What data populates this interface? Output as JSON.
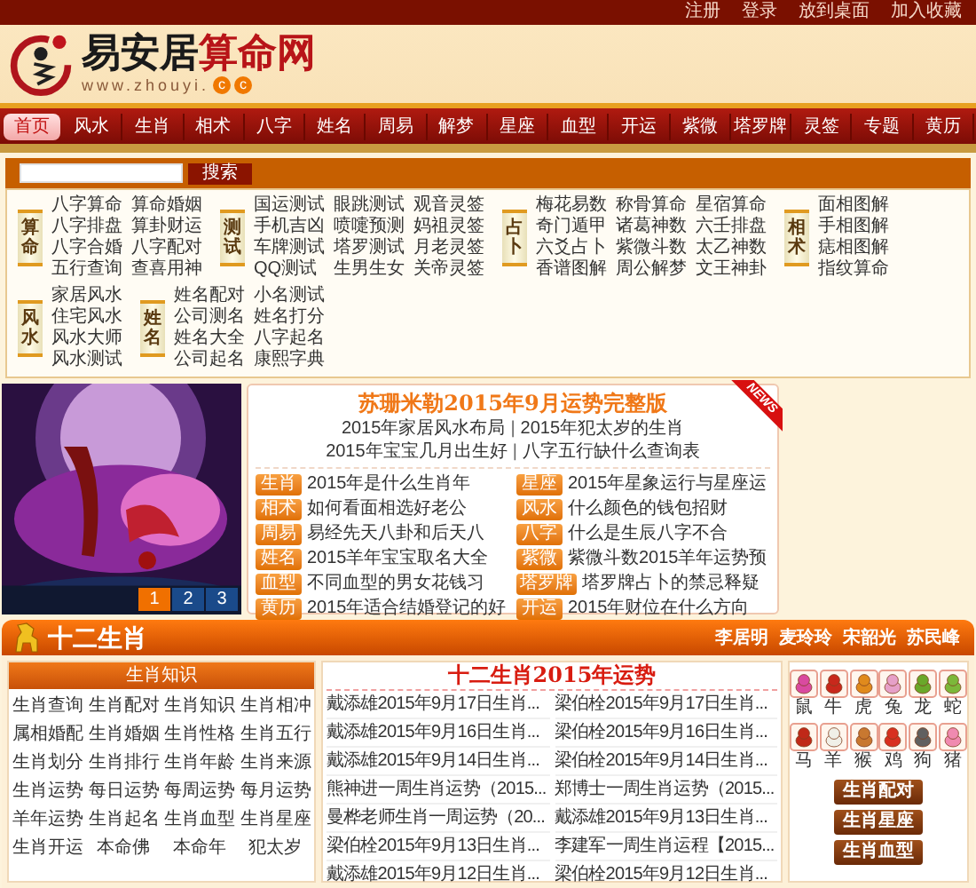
{
  "top_links": [
    "注册",
    "登录",
    "放到桌面",
    "加入收藏"
  ],
  "logo": {
    "name_black": "易安居",
    "name_red": "算命网",
    "url": "www.zhouyi.",
    "url_badges": [
      "c",
      "c"
    ]
  },
  "nav": [
    {
      "label": "首页",
      "selected": true
    },
    {
      "label": "风水",
      "selected": false
    },
    {
      "label": "生肖",
      "selected": false
    },
    {
      "label": "相术",
      "selected": false
    },
    {
      "label": "八字",
      "selected": false
    },
    {
      "label": "姓名",
      "selected": false
    },
    {
      "label": "周易",
      "selected": false
    },
    {
      "label": "解梦",
      "selected": false
    },
    {
      "label": "星座",
      "selected": false
    },
    {
      "label": "血型",
      "selected": false
    },
    {
      "label": "开运",
      "selected": false
    },
    {
      "label": "紫微",
      "selected": false
    },
    {
      "label": "塔罗牌",
      "selected": false
    },
    {
      "label": "灵签",
      "selected": false
    },
    {
      "label": "专题",
      "selected": false
    },
    {
      "label": "黄历",
      "selected": false
    }
  ],
  "search": {
    "button": "搜索"
  },
  "categories": [
    {
      "label": "算命",
      "columns": [
        [
          "八字算命",
          "八字排盘",
          "八字合婚",
          "五行查询"
        ],
        [
          "算命婚姻",
          "算卦财运",
          "八字配对",
          "查喜用神"
        ]
      ]
    },
    {
      "label": "测试",
      "columns": [
        [
          "国运测试",
          "手机吉凶",
          "车牌测试",
          "QQ测试"
        ],
        [
          "眼跳测试",
          "喷嚏预测",
          "塔罗测试",
          "生男生女"
        ],
        [
          "观音灵签",
          "妈祖灵签",
          "月老灵签",
          "关帝灵签"
        ]
      ]
    },
    {
      "label": "占卜",
      "columns": [
        [
          "梅花易数",
          "奇门遁甲",
          "六爻占卜",
          "香谱图解"
        ],
        [
          "称骨算命",
          "诸葛神数",
          "紫微斗数",
          "周公解梦"
        ],
        [
          "星宿算命",
          "六壬排盘",
          "太乙神数",
          "文王神卦"
        ]
      ]
    },
    {
      "label": "相术",
      "columns": [
        [
          "面相图解",
          "手相图解",
          "痣相图解",
          "指纹算命"
        ]
      ]
    },
    {
      "label": "风水",
      "columns": [
        [
          "家居风水",
          "住宅风水",
          "风水大师",
          "风水测试"
        ]
      ]
    },
    {
      "label": "姓名",
      "columns": [
        [
          "姓名配对",
          "公司测名",
          "姓名大全",
          "公司起名"
        ],
        [
          "小名测试",
          "姓名打分",
          "八字起名",
          "康熙字典"
        ]
      ]
    }
  ],
  "slideshow": {
    "pages": [
      {
        "label": "1",
        "selected": true
      },
      {
        "label": "2",
        "selected": false
      },
      {
        "label": "3",
        "selected": false
      }
    ]
  },
  "news": {
    "ribbon": "NEWS",
    "headline": "苏珊米勒2015年9月运势完整版",
    "sub_lines": [
      {
        "links": [
          "2015年家居风水布局",
          "2015年犯太岁的生肖"
        ],
        "separator": "|"
      },
      {
        "links": [
          "2015年宝宝几月出生好",
          "八字五行缺什么查询表"
        ],
        "separator": "|"
      }
    ],
    "columns": [
      [
        {
          "tag": "生肖",
          "title": "2015年是什么生肖年"
        },
        {
          "tag": "相术",
          "title": "如何看面相选好老公"
        },
        {
          "tag": "周易",
          "title": "易经先天八卦和后天八"
        },
        {
          "tag": "姓名",
          "title": "2015羊年宝宝取名大全"
        },
        {
          "tag": "血型",
          "title": "不同血型的男女花钱习"
        },
        {
          "tag": "黄历",
          "title": "2015年适合结婚登记的好"
        }
      ],
      [
        {
          "tag": "星座",
          "title": "2015年星象运行与星座运"
        },
        {
          "tag": "风水",
          "title": "什么颜色的钱包招财"
        },
        {
          "tag": "八字",
          "title": "什么是生辰八字不合"
        },
        {
          "tag": "紫微",
          "title": "紫微斗数2015羊年运势预"
        },
        {
          "tag": "塔罗牌",
          "title": "塔罗牌占卜的禁忌释疑"
        },
        {
          "tag": "开运",
          "title": "2015年财位在什么方向"
        }
      ]
    ]
  },
  "zodiac_section": {
    "title": "十二生肖",
    "masters": [
      "李居明",
      "麦玲玲",
      "宋韶光",
      "苏民峰"
    ],
    "knowledge": {
      "title": "生肖知识",
      "items": [
        "生肖查询",
        "生肖配对",
        "生肖知识",
        "生肖相冲",
        "属相婚配",
        "生肖婚姻",
        "生肖性格",
        "生肖五行",
        "生肖划分",
        "生肖排行",
        "生肖年龄",
        "生肖来源",
        "生肖运势",
        "每日运势",
        "每周运势",
        "每月运势",
        "羊年运势",
        "生肖起名",
        "生肖血型",
        "生肖星座",
        "生肖开运",
        "本命佛",
        "本命年",
        "犯太岁"
      ]
    },
    "fortune": {
      "title": "十二生肖2015年运势",
      "columns": [
        [
          "戴添雄2015年9月17日生肖...",
          "戴添雄2015年9月16日生肖...",
          "戴添雄2015年9月14日生肖...",
          "熊神进一周生肖运势（2015...",
          "曼桦老师生肖一周运势（20...",
          "梁伯栓2015年9月13日生肖...",
          "戴添雄2015年9月12日生肖..."
        ],
        [
          "梁伯栓2015年9月17日生肖...",
          "梁伯栓2015年9月16日生肖...",
          "梁伯栓2015年9月14日生肖...",
          "郑博士一周生肖运势（2015...",
          "戴添雄2015年9月13日生肖...",
          "李建军一周生肖运程【2015...",
          "梁伯栓2015年9月12日生肖..."
        ]
      ]
    },
    "animals": [
      "鼠",
      "牛",
      "虎",
      "兔",
      "龙",
      "蛇",
      "马",
      "羊",
      "猴",
      "鸡",
      "狗",
      "猪"
    ],
    "buttons": [
      "生肖配对",
      "生肖星座",
      "生肖血型"
    ]
  }
}
